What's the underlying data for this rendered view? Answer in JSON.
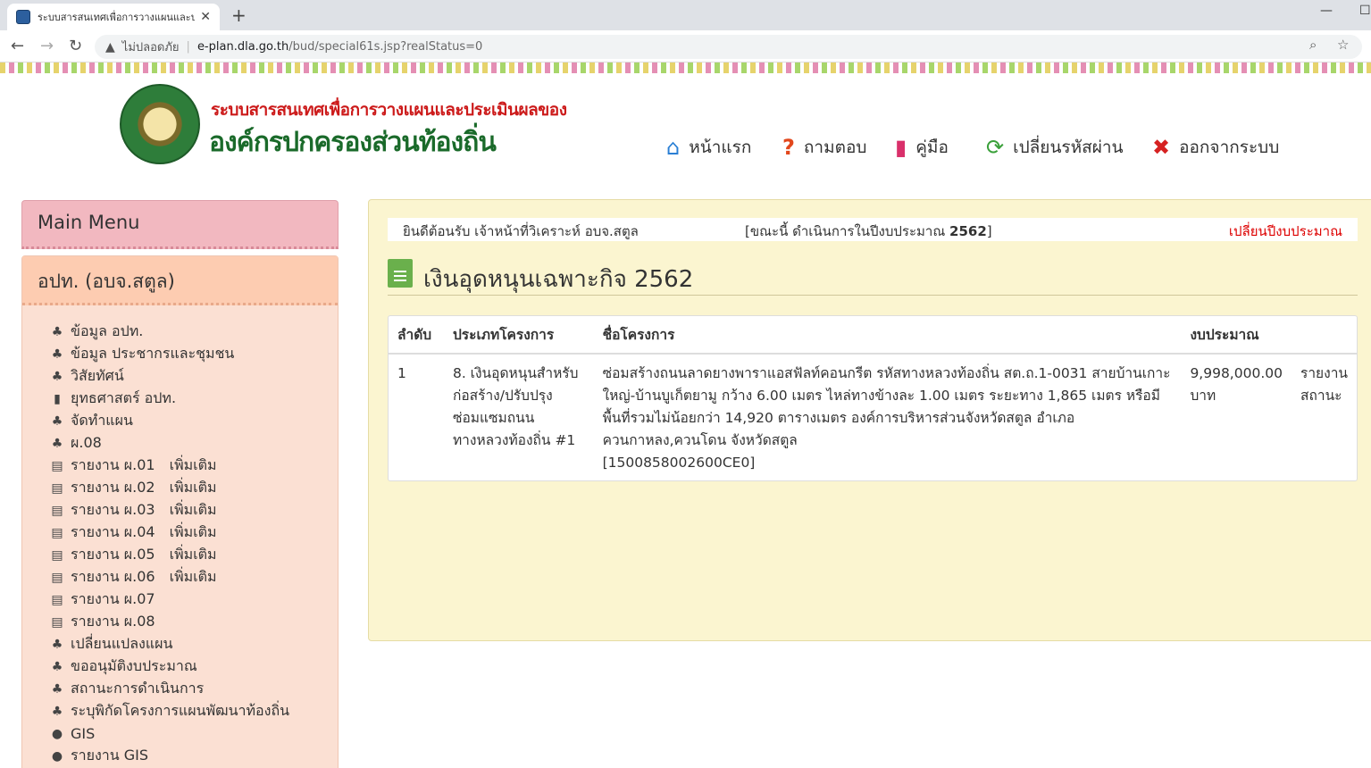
{
  "browser": {
    "tab_title": "ระบบสารสนเทศเพื่อการวางแผนและประ",
    "tab_close": "✕",
    "new_tab": "+",
    "security_label": "ไม่ปลอดภัย",
    "url_domain": "e-plan.dla.go.th",
    "url_path": "/bud/special61s.jsp?realStatus=0"
  },
  "header": {
    "title_line1": "ระบบสารสนเทศเพื่อการวางแผนและประเมินผลของ",
    "title_line2": "องค์กรปกครองส่วนท้องถิ่น",
    "nav": [
      {
        "label": "หน้าแรก",
        "icon": "home-icon",
        "color": "#2a7fd4"
      },
      {
        "label": "ถามตอบ",
        "icon": "question-icon",
        "color": "#e2471c"
      },
      {
        "label": "คู่มือ",
        "icon": "book-icon",
        "color": "#d9306b"
      },
      {
        "label": "เปลี่ยนรหัสผ่าน",
        "icon": "refresh-icon",
        "color": "#3aa03a"
      },
      {
        "label": "ออกจากระบบ",
        "icon": "close-icon",
        "color": "#d62222"
      }
    ]
  },
  "sidebar": {
    "main_menu": "Main Menu",
    "org_title": "อปท. (อบจ.สตูล)",
    "more_label": "เพิ่มเติม",
    "items": [
      {
        "label": "ข้อมูล อปท.",
        "icon": "sitemap-icon",
        "more": false
      },
      {
        "label": "ข้อมูล ประชากรและชุมชน",
        "icon": "sitemap-icon",
        "more": false
      },
      {
        "label": "วิสัยทัศน์",
        "icon": "sitemap-icon",
        "more": false
      },
      {
        "label": "ยุทธศาสตร์ อปท.",
        "icon": "bookmark-icon",
        "more": false
      },
      {
        "label": "จัดทำแผน",
        "icon": "sitemap-icon",
        "more": false
      },
      {
        "label": "ผ.08",
        "icon": "sitemap-icon",
        "more": false
      },
      {
        "label": "รายงาน ผ.01",
        "icon": "file-icon",
        "more": true
      },
      {
        "label": "รายงาน ผ.02",
        "icon": "file-icon",
        "more": true
      },
      {
        "label": "รายงาน ผ.03",
        "icon": "file-icon",
        "more": true
      },
      {
        "label": "รายงาน ผ.04",
        "icon": "file-icon",
        "more": true
      },
      {
        "label": "รายงาน ผ.05",
        "icon": "file-icon",
        "more": true
      },
      {
        "label": "รายงาน ผ.06",
        "icon": "file-icon",
        "more": true
      },
      {
        "label": "รายงาน ผ.07",
        "icon": "file-icon",
        "more": false
      },
      {
        "label": "รายงาน ผ.08",
        "icon": "file-icon",
        "more": false
      },
      {
        "label": "เปลี่ยนแปลงแผน",
        "icon": "sitemap-icon",
        "more": false
      },
      {
        "label": "ขออนุมัติงบประมาณ",
        "icon": "sitemap-icon",
        "more": false
      },
      {
        "label": "สถานะการดำเนินการ",
        "icon": "sitemap-icon",
        "more": false
      },
      {
        "label": "ระบุพิกัดโครงการแผนพัฒนาท้องถิ่น",
        "icon": "sitemap-icon",
        "more": false
      },
      {
        "label": "GIS",
        "icon": "globe-icon",
        "more": false
      },
      {
        "label": "รายงาน GIS",
        "icon": "globe-icon",
        "more": false
      }
    ]
  },
  "welcome": {
    "greeting": "ยินดีต้อนรับ เจ้าหน้าที่วิเคราะห์ อบจ.สตูล",
    "year_prefix": "[ขณะนี้ ดำเนินการในปีงบประมาณ ",
    "year": "2562",
    "year_suffix": "]",
    "change_year": "เปลี่ยนปีงบประมาณ"
  },
  "page": {
    "title": "เงินอุดหนุนเฉพาะกิจ 2562"
  },
  "table": {
    "headers": [
      "ลำดับ",
      "ประเภทโครงการ",
      "ชื่อโครงการ",
      "งบประมาณ",
      ""
    ],
    "rows": [
      {
        "no": "1",
        "type": "8. เงินอุดหนุนสำหรับก่อสร้าง/ปรับปรุง ซ่อมแซมถนน ทางหลวงท้องถิ่น #1",
        "name": "ซ่อมสร้างถนนลาดยางพาราแอสฟัลท์คอนกรีต รหัสทางหลวงท้องถิ่น สต.ถ.1-0031 สายบ้านเกาะใหญ่-บ้านบูเก็ตยามู กว้าง 6.00 เมตร ไหล่ทางข้างละ 1.00 เมตร ระยะทาง 1,865 เมตร หรือมีพื้นที่รวมไม่น้อยกว่า 14,920 ตารางเมตร องค์การบริหารส่วนจังหวัดสตูล อำเภอควนกาหลง,ควนโดน จังหวัดสตูล",
        "code": "[1500858002600CE0]",
        "budget": "9,998,000.00 บาท",
        "action": "รายงานสถานะ"
      }
    ]
  }
}
